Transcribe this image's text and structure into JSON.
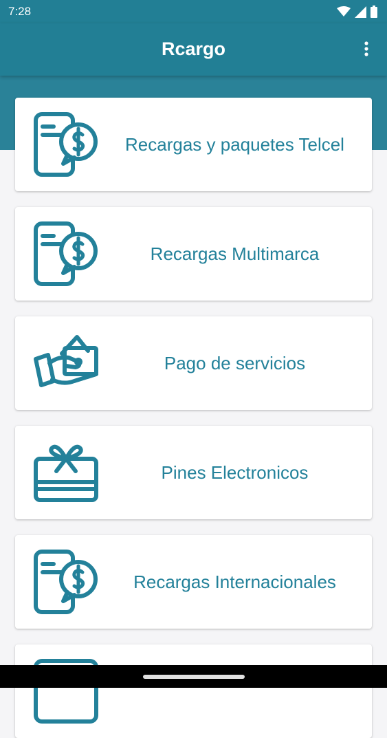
{
  "status_bar": {
    "time": "7:28"
  },
  "app_bar": {
    "title": "Rcargo"
  },
  "colors": {
    "primary": "#227f95",
    "accent_text": "#23819a"
  },
  "menu": [
    {
      "label": "Recargas y paquetes Telcel",
      "icon": "phone-dollar-icon"
    },
    {
      "label": "Recargas Multimarca",
      "icon": "phone-dollar-icon"
    },
    {
      "label": "Pago de servicios",
      "icon": "hand-payment-icon"
    },
    {
      "label": "Pines Electronicos",
      "icon": "gift-card-icon"
    },
    {
      "label": "Recargas Internacionales",
      "icon": "phone-dollar-icon"
    }
  ]
}
